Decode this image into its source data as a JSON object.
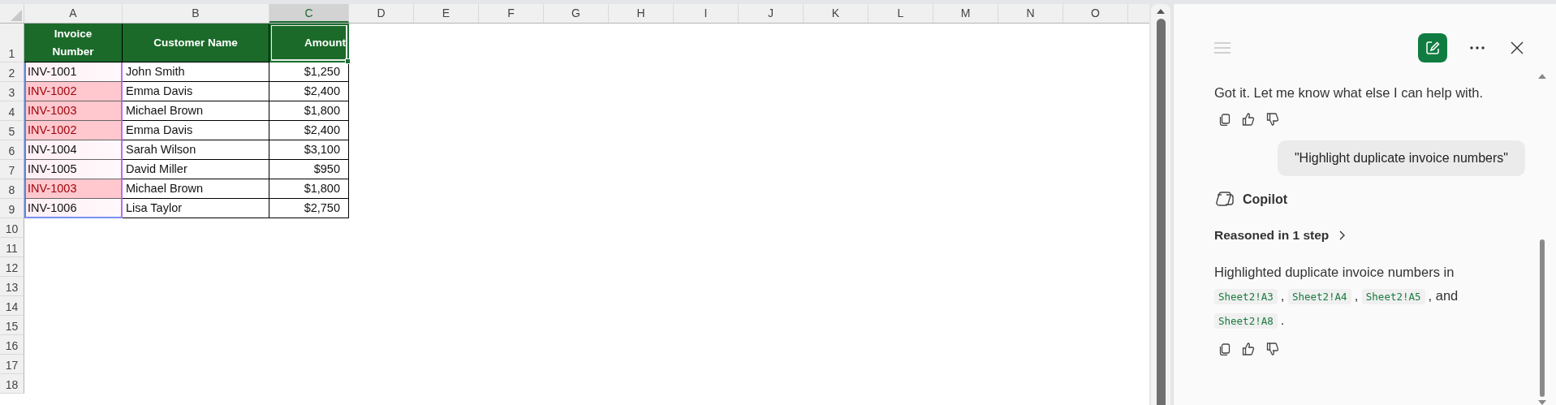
{
  "sheet": {
    "columns": [
      {
        "label": "A",
        "selected": false
      },
      {
        "label": "B",
        "selected": false
      },
      {
        "label": "C",
        "selected": true
      },
      {
        "label": "D",
        "selected": false
      },
      {
        "label": "E",
        "selected": false
      },
      {
        "label": "F",
        "selected": false
      },
      {
        "label": "G",
        "selected": false
      },
      {
        "label": "H",
        "selected": false
      },
      {
        "label": "I",
        "selected": false
      },
      {
        "label": "J",
        "selected": false
      },
      {
        "label": "K",
        "selected": false
      },
      {
        "label": "L",
        "selected": false
      },
      {
        "label": "M",
        "selected": false
      },
      {
        "label": "N",
        "selected": false
      },
      {
        "label": "O",
        "selected": false
      }
    ],
    "row_numbers": [
      "1",
      "2",
      "3",
      "4",
      "5",
      "6",
      "7",
      "8",
      "9",
      "10",
      "11",
      "12",
      "13",
      "14",
      "15",
      "16",
      "17",
      "18"
    ],
    "header": [
      {
        "text": "Invoice Number",
        "selected": false
      },
      {
        "text": "Customer Name",
        "selected": false
      },
      {
        "text": "Amount",
        "selected": true
      }
    ],
    "rows": [
      {
        "invoice": "INV-1001",
        "duplicate": false,
        "customer": "John Smith",
        "amount": "$1,250"
      },
      {
        "invoice": "INV-1002",
        "duplicate": true,
        "customer": "Emma Davis",
        "amount": "$2,400"
      },
      {
        "invoice": "INV-1003",
        "duplicate": true,
        "customer": "Michael Brown",
        "amount": "$1,800"
      },
      {
        "invoice": "INV-1002",
        "duplicate": true,
        "customer": "Emma Davis",
        "amount": "$2,400"
      },
      {
        "invoice": "INV-1004",
        "duplicate": false,
        "customer": "Sarah Wilson",
        "amount": "$3,100"
      },
      {
        "invoice": "INV-1005",
        "duplicate": false,
        "customer": "David Miller",
        "amount": "$950"
      },
      {
        "invoice": "INV-1003",
        "duplicate": true,
        "customer": "Michael Brown",
        "amount": "$1,800"
      },
      {
        "invoice": "INV-1006",
        "duplicate": false,
        "customer": "Lisa Taylor",
        "amount": "$2,750"
      }
    ]
  },
  "copilot_pane": {
    "messages": [
      {
        "kind": "assistant",
        "text": "Got it. Let me know what else I can help with.",
        "feedback": true
      },
      {
        "kind": "user",
        "text": "\"Highlight duplicate invoice numbers\""
      },
      {
        "kind": "sender",
        "text": "Copilot"
      },
      {
        "kind": "reasoning",
        "text": "Reasoned in 1 step"
      },
      {
        "kind": "assistant_refs",
        "feedback": true,
        "parts": [
          {
            "text": "Highlighted duplicate invoice numbers in "
          },
          {
            "ref": "Sheet2!A3"
          },
          {
            "text": ", "
          },
          {
            "ref": "Sheet2!A4"
          },
          {
            "text": ", "
          },
          {
            "ref": "Sheet2!A5"
          },
          {
            "text": ", and "
          },
          {
            "ref": "Sheet2!A8"
          },
          {
            "text": "."
          }
        ]
      }
    ]
  }
}
